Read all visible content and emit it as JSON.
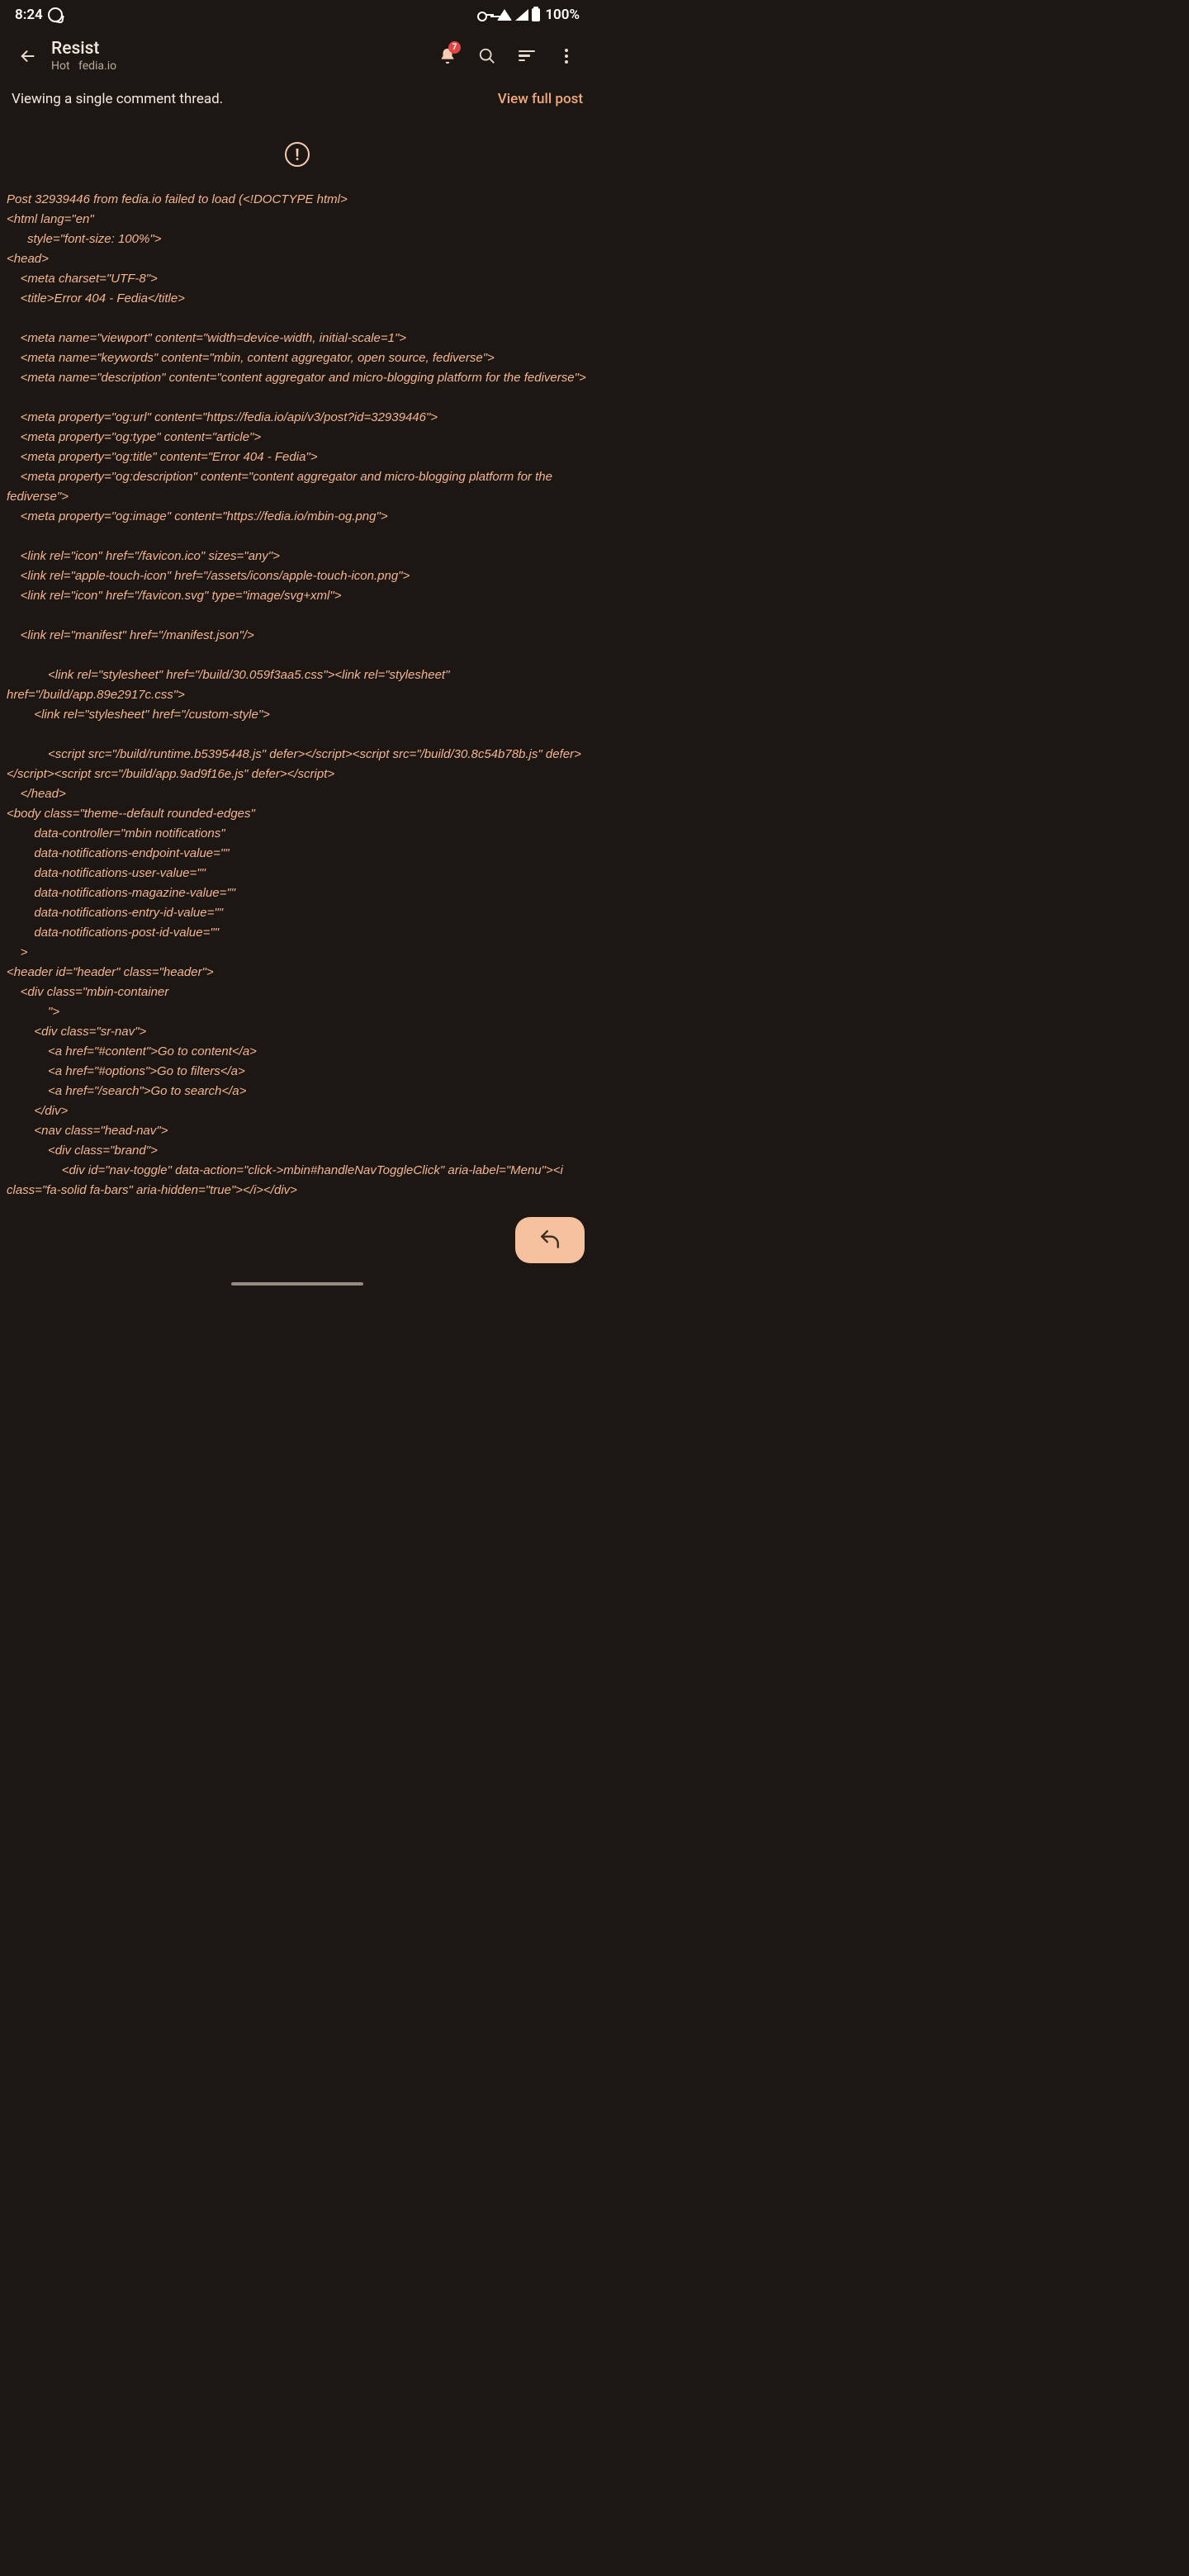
{
  "status": {
    "time": "8:24",
    "battery_text": "100%"
  },
  "appbar": {
    "title": "Resist",
    "subtitle_sort": "Hot",
    "subtitle_host": "fedia.io",
    "notification_count": "7"
  },
  "banner": {
    "left": "Viewing a single comment thread.",
    "right": "View full post"
  },
  "error_glyph": "!",
  "error_text": "Post 32939446 from fedia.io failed to load (<!DOCTYPE html>\n<html lang=\"en\"\n      style=\"font-size: 100%\">\n<head>\n    <meta charset=\"UTF-8\">\n    <title>Error 404 - Fedia</title>\n\n    <meta name=\"viewport\" content=\"width=device-width, initial-scale=1\">\n    <meta name=\"keywords\" content=\"mbin, content aggregator, open source, fediverse\">\n    <meta name=\"description\" content=\"content aggregator and micro-blogging platform for the fediverse\">\n\n    <meta property=\"og:url\" content=\"https://fedia.io/api/v3/post?id=32939446\">\n    <meta property=\"og:type\" content=\"article\">\n    <meta property=\"og:title\" content=\"Error 404 - Fedia\">\n    <meta property=\"og:description\" content=\"content aggregator and micro-blogging platform for the fediverse\">\n    <meta property=\"og:image\" content=\"https://fedia.io/mbin-og.png\">\n\n    <link rel=\"icon\" href=\"/favicon.ico\" sizes=\"any\">\n    <link rel=\"apple-touch-icon\" href=\"/assets/icons/apple-touch-icon.png\">\n    <link rel=\"icon\" href=\"/favicon.svg\" type=\"image/svg+xml\">\n\n    <link rel=\"manifest\" href=\"/manifest.json\"/>\n\n            <link rel=\"stylesheet\" href=\"/build/30.059f3aa5.css\"><link rel=\"stylesheet\" href=\"/build/app.89e2917c.css\">\n        <link rel=\"stylesheet\" href=\"/custom-style\">\n\n            <script src=\"/build/runtime.b5395448.js\" defer></script><script src=\"/build/30.8c54b78b.js\" defer></script><script src=\"/build/app.9ad9f16e.js\" defer></script>\n    </head>\n<body class=\"theme--default rounded-edges\"\n        data-controller=\"mbin notifications\"\n        data-notifications-endpoint-value=\"\"\n        data-notifications-user-value=\"\"\n        data-notifications-magazine-value=\"\"\n        data-notifications-entry-id-value=\"\"\n        data-notifications-post-id-value=\"\"\n    >\n<header id=\"header\" class=\"header\">\n    <div class=\"mbin-container\n            \">\n        <div class=\"sr-nav\">\n            <a href=\"#content\">Go to content</a>\n            <a href=\"#options\">Go to filters</a>\n            <a href=\"/search\">Go to search</a>\n        </div>\n        <nav class=\"head-nav\">\n            <div class=\"brand\">\n                <div id=\"nav-toggle\" data-action=\"click->mbin#handleNavToggleClick\" aria-label=\"Menu\"><i class=\"fa-solid fa-bars\" aria-hidden=\"true\"></i></div>"
}
